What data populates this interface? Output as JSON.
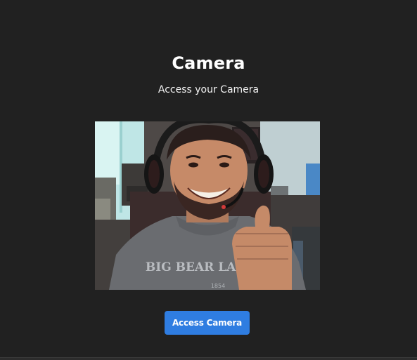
{
  "header": {
    "title": "Camera",
    "subtitle": "Access your Camera"
  },
  "camera": {
    "shirt_print_text": "BIG BEAR LAKE",
    "shirt_print_year": "1854"
  },
  "actions": {
    "access_camera_label": "Access Camera"
  },
  "colors": {
    "background": "#212121",
    "button": "#2f7de1",
    "text": "#ffffff"
  }
}
